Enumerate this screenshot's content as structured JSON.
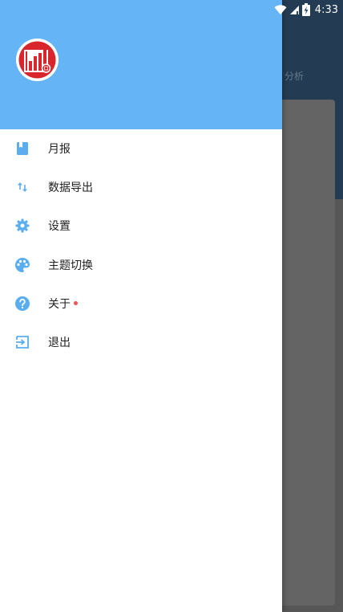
{
  "status_bar": {
    "time": "4:33"
  },
  "background": {
    "tab_partial_text": "分析"
  },
  "drawer": {
    "header_color": "#64b4f6",
    "logo_icon": "bar-chart-logo-icon",
    "menu": [
      {
        "label": "月报",
        "icon": "book-icon"
      },
      {
        "label": "数据导出",
        "icon": "swap-vertical-icon"
      },
      {
        "label": "设置",
        "icon": "gear-icon"
      },
      {
        "label": "主题切换",
        "icon": "palette-icon"
      },
      {
        "label": "关于",
        "icon": "help-circle-icon",
        "badge": "red-dot"
      },
      {
        "label": "退出",
        "icon": "exit-icon"
      }
    ]
  },
  "colors": {
    "accent": "#64b4f6",
    "icon": "#5aaeef",
    "badge": "#ef5350",
    "logo_red": "#d9262c"
  }
}
